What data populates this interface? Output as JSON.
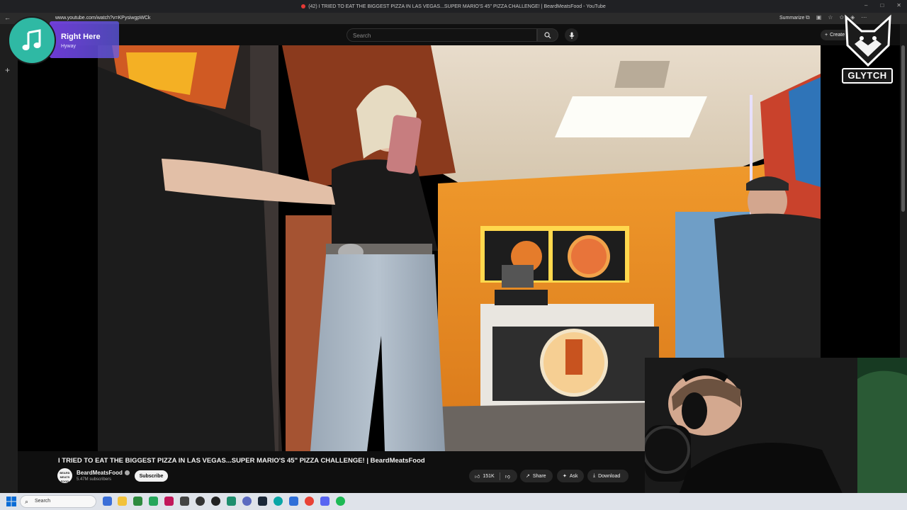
{
  "browser": {
    "window_title": "(42) I TRIED TO EAT THE BIGGEST PIZZA IN LAS VEGAS...SUPER MARIO'S 45\" PIZZA CHALLENGE! | BeardMeatsFood - YouTube",
    "url": "www.youtube.com/watch?v=KPysiwgpWCk",
    "summarize_label": "Summarize"
  },
  "youtube": {
    "search_placeholder": "Search",
    "create_label": "Create",
    "video_title": "I TRIED TO EAT THE BIGGEST PIZZA IN LAS VEGAS...SUPER MARIO'S 45\" PIZZA CHALLENGE! | BeardMeatsFood",
    "channel_avatar_text": "BEARD MEATS FOOD",
    "channel_name": "BeardMeatsFood",
    "subscribers": "5.47M subscribers",
    "subscribe_label": "Subscribe",
    "likes": "151K",
    "share_label": "Share",
    "ask_label": "Ask",
    "download_label": "Download"
  },
  "overlay": {
    "song_title": "Right Here",
    "song_artist": "Hyway",
    "brand_logo_text": "GLYTCH"
  },
  "taskbar": {
    "search_placeholder": "Search"
  },
  "colors": {
    "accent_music": "#2fb9a4",
    "youtube_red": "#e53935",
    "orange_wall": "#e8891e"
  }
}
